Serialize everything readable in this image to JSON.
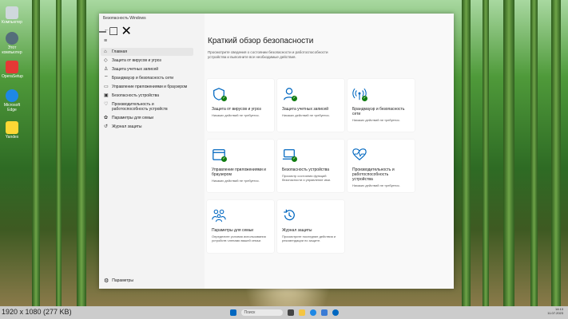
{
  "desktop": {
    "icons": [
      {
        "label": "Компьютер",
        "color": "#cfd8dc"
      },
      {
        "label": "Этот компьютер",
        "color": "#546e7a"
      },
      {
        "label": "OperaSetup",
        "color": "#e53935"
      },
      {
        "label": "Microsoft Edge",
        "color": "#1e88e5"
      },
      {
        "label": "Yandex",
        "color": "#fdd835"
      }
    ]
  },
  "window": {
    "title": "Безопасность Windows",
    "controls": {
      "minimize": "–",
      "maximize": "□",
      "close": "✕"
    }
  },
  "nav": {
    "back": "←",
    "menu": "≡",
    "items": [
      {
        "icon": "⌂",
        "label": "Главная"
      },
      {
        "icon": "◇",
        "label": "Защита от вирусов и угроз"
      },
      {
        "icon": "♙",
        "label": "Защита учетных записей"
      },
      {
        "icon": "⌔",
        "label": "Брандмауэр и безопасность сети"
      },
      {
        "icon": "▭",
        "label": "Управление приложениями и браузером"
      },
      {
        "icon": "▣",
        "label": "Безопасность устройства"
      },
      {
        "icon": "♡",
        "label": "Производительность и работоспособность устройств"
      },
      {
        "icon": "✿",
        "label": "Параметры для семьи"
      },
      {
        "icon": "↺",
        "label": "Журнал защиты"
      }
    ],
    "settings": {
      "icon": "⚙",
      "label": "Параметры"
    }
  },
  "main": {
    "title": "Краткий обзор безопасности",
    "description": "Просмотрите сведения о состоянии безопасности и работоспособности устройства и выполните все необходимые действия.",
    "tiles": [
      {
        "icon": "shield",
        "title": "Защита от вирусов и угроз",
        "subtitle": "Никаких действий не требуется."
      },
      {
        "icon": "person",
        "title": "Защита учетных записей",
        "subtitle": "Никаких действий не требуется."
      },
      {
        "icon": "wifi",
        "title": "Брандмауэр и безопасность сети",
        "subtitle": "Никаких действий не требуется."
      },
      {
        "icon": "browser",
        "title": "Управление приложениями и браузером",
        "subtitle": "Никаких действий не требуется."
      },
      {
        "icon": "laptop",
        "title": "Безопасность устройства",
        "subtitle": "Просмотр состояния функций безопасности и управление ими."
      },
      {
        "icon": "heart",
        "title": "Производительность и работоспособность устройства",
        "subtitle": "Никаких действий не требуется."
      },
      {
        "icon": "family",
        "title": "Параметры для семьи",
        "subtitle": "Определите условия использования устройств членами вашей семьи."
      },
      {
        "icon": "history",
        "title": "Журнал защиты",
        "subtitle": "Просмотрите последние действия и рекомендации по защите."
      }
    ]
  },
  "status_bar": {
    "size_label": "1920 x 1080 (277 KB)"
  },
  "taskbar": {
    "search_placeholder": "Поиск",
    "time": "14:13",
    "date": "11.07.2023"
  },
  "colors": {
    "accent": "#0067c0",
    "ok": "#107c10"
  }
}
